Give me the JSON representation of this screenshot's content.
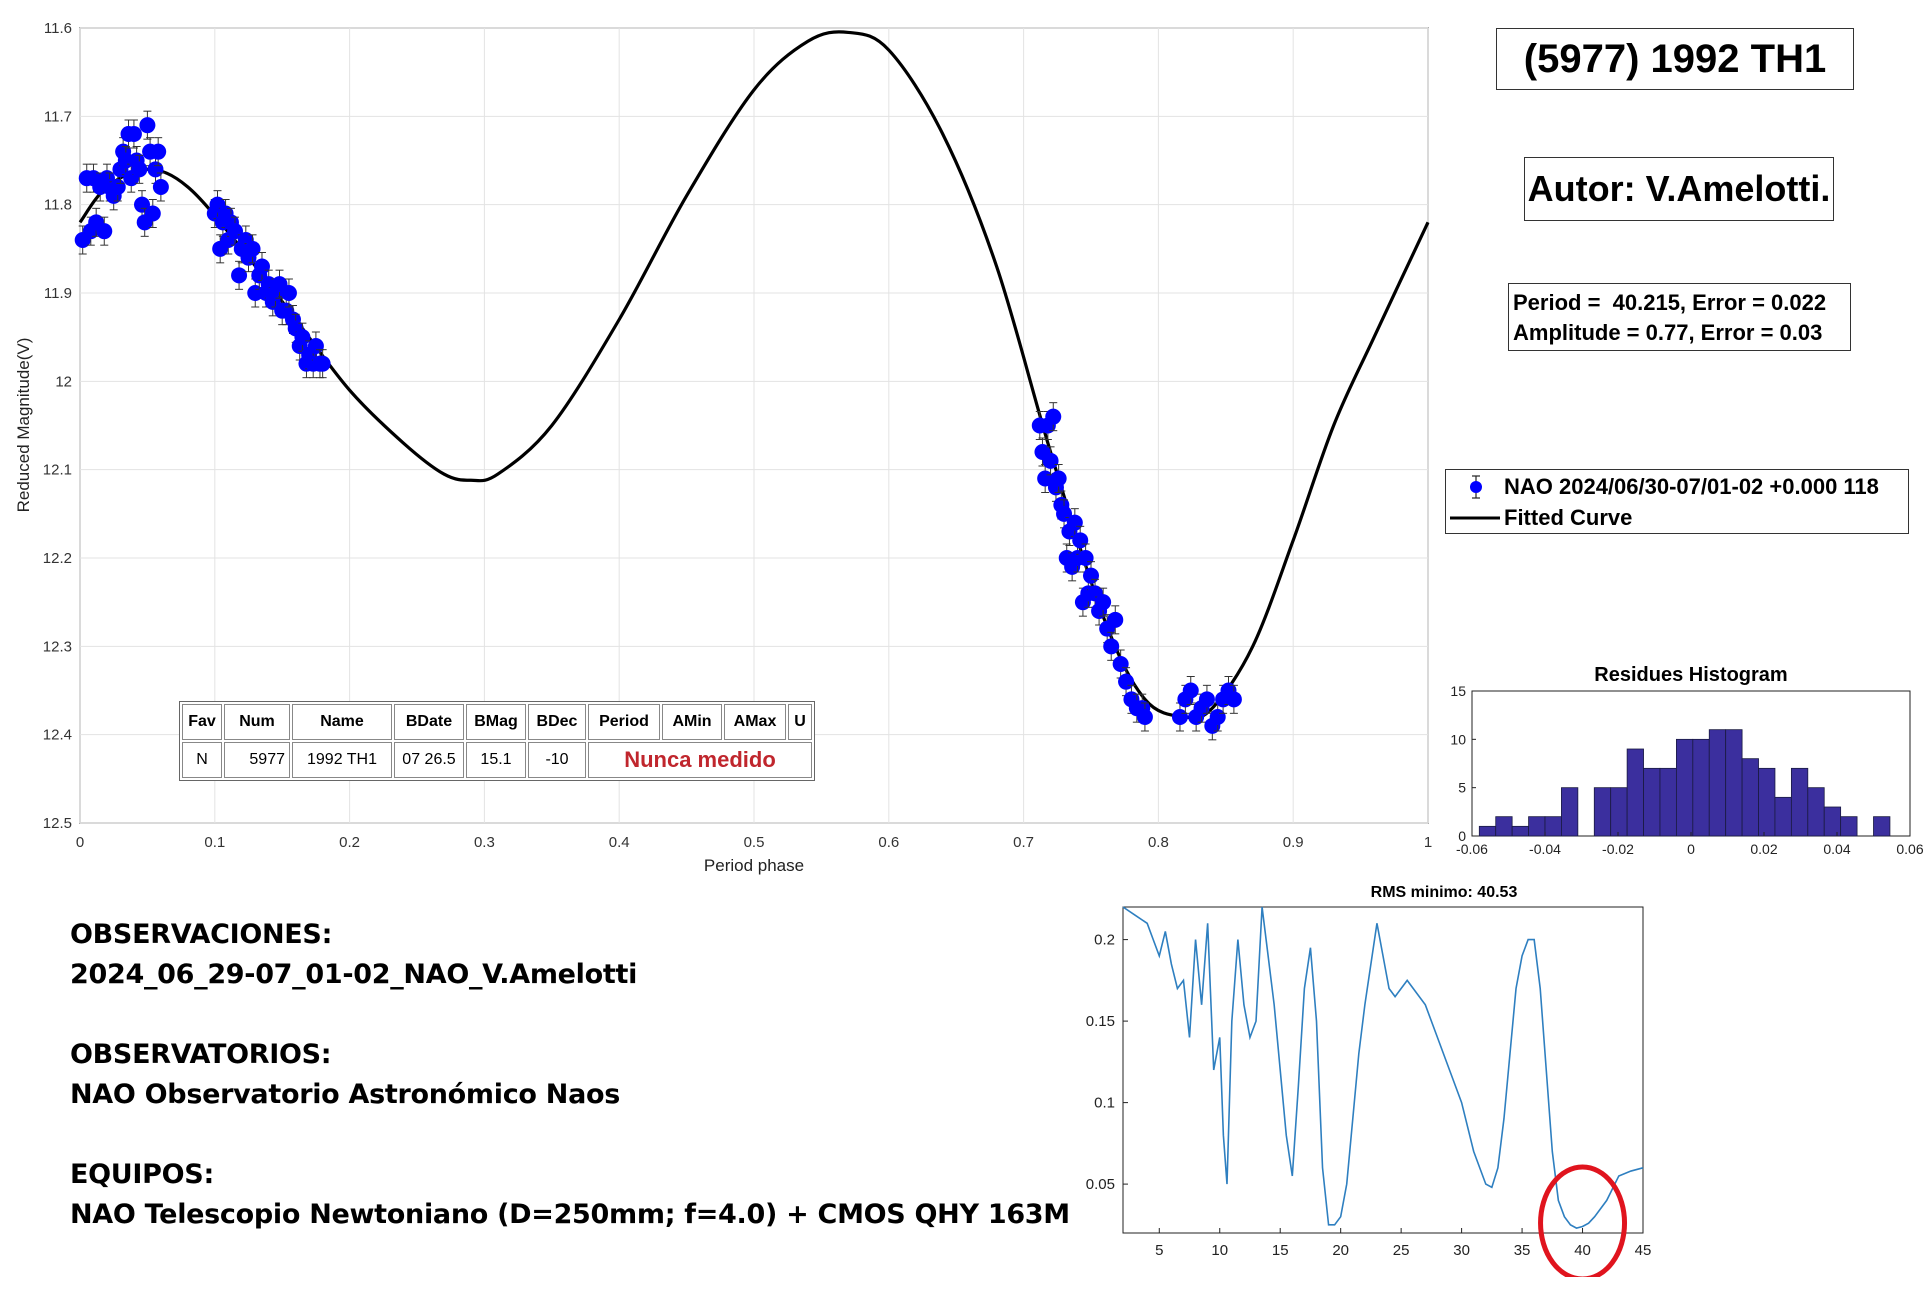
{
  "title": "(5977) 1992 TH1",
  "author": "Autor: V.Amelotti.",
  "params": {
    "period_line": "Period =  40.215, Error = 0.022",
    "amplitude_line": "Amplitude = 0.77, Error = 0.03"
  },
  "legend": {
    "series_label": "NAO 2024/06/30-07/01-02 +0.000 118",
    "fit_label": "Fitted Curve"
  },
  "observations": {
    "obs_header": "OBSERVACIONES:",
    "obs_value": "2024_06_29-07_01-02_NAO_V.Amelotti",
    "obsv_header": "OBSERVATORIOS:",
    "obsv_value": "NAO Observatorio Astronómico Naos",
    "equip_header": "EQUIPOS:",
    "equip_value": "NAO Telescopio Newtoniano (D=250mm; f=4.0) + CMOS QHY 163M"
  },
  "info_table": {
    "headers": [
      "Fav",
      "Num",
      "Name",
      "BDate",
      "BMag",
      "BDec",
      "Period",
      "AMin",
      "AMax",
      "U"
    ],
    "row": [
      "N",
      "5977",
      "1992 TH1",
      "07 26.5",
      "15.1",
      "-10"
    ],
    "note": "Nunca medido"
  },
  "colors": {
    "points": "#0000ff",
    "fit": "#000000",
    "histogram": "#3b2f9e",
    "rms": "#2e7fc0",
    "circle": "#e0141e"
  },
  "chart_data": [
    {
      "type": "scatter",
      "xlabel": "Period phase",
      "ylabel": "Reduced Magnitude(V)",
      "xlim": [
        0,
        1
      ],
      "ylim": [
        12.5,
        11.6
      ],
      "y_reversed": true,
      "grid": true,
      "xticks": [
        "0",
        "0.1",
        "0.2",
        "0.3",
        "0.4",
        "0.5",
        "0.6",
        "0.7",
        "0.8",
        "0.9",
        "1"
      ],
      "yticks": [
        "11.6",
        "11.7",
        "11.8",
        "11.9",
        "12",
        "12.1",
        "12.2",
        "12.3",
        "12.4",
        "12.5"
      ],
      "fit": {
        "type": "line",
        "name": "Fitted Curve",
        "x": [
          0,
          0.02,
          0.05,
          0.08,
          0.12,
          0.16,
          0.2,
          0.24,
          0.27,
          0.29,
          0.31,
          0.35,
          0.4,
          0.45,
          0.5,
          0.54,
          0.57,
          0.6,
          0.64,
          0.68,
          0.72,
          0.76,
          0.79,
          0.82,
          0.84,
          0.87,
          0.9,
          0.93,
          0.96,
          1.0
        ],
        "y": [
          11.82,
          11.78,
          11.76,
          11.78,
          11.85,
          11.93,
          12.01,
          12.07,
          12.105,
          12.112,
          12.105,
          12.05,
          11.93,
          11.79,
          11.67,
          11.615,
          11.605,
          11.625,
          11.72,
          11.87,
          12.08,
          12.27,
          12.36,
          12.38,
          12.37,
          12.3,
          12.18,
          12.05,
          11.95,
          11.82
        ]
      },
      "series": [
        {
          "name": "NAO 2024/06/30-07/01-02 +0.000 118",
          "x": [
            0.002,
            0.005,
            0.008,
            0.01,
            0.012,
            0.015,
            0.018,
            0.02,
            0.022,
            0.025,
            0.028,
            0.03,
            0.032,
            0.034,
            0.036,
            0.038,
            0.04,
            0.042,
            0.044,
            0.046,
            0.048,
            0.05,
            0.052,
            0.054,
            0.056,
            0.058,
            0.06,
            0.1,
            0.102,
            0.104,
            0.106,
            0.108,
            0.11,
            0.112,
            0.115,
            0.118,
            0.12,
            0.123,
            0.125,
            0.128,
            0.13,
            0.133,
            0.135,
            0.138,
            0.14,
            0.143,
            0.145,
            0.148,
            0.15,
            0.153,
            0.155,
            0.158,
            0.16,
            0.163,
            0.165,
            0.168,
            0.17,
            0.173,
            0.175,
            0.178,
            0.18,
            0.712,
            0.714,
            0.716,
            0.718,
            0.72,
            0.722,
            0.724,
            0.726,
            0.728,
            0.73,
            0.732,
            0.734,
            0.736,
            0.738,
            0.74,
            0.742,
            0.744,
            0.746,
            0.748,
            0.75,
            0.753,
            0.756,
            0.759,
            0.762,
            0.765,
            0.768,
            0.772,
            0.776,
            0.78,
            0.784,
            0.788,
            0.79,
            0.816,
            0.82,
            0.824,
            0.828,
            0.832,
            0.836,
            0.84,
            0.844,
            0.848,
            0.852,
            0.856
          ],
          "y": [
            11.84,
            11.77,
            11.83,
            11.77,
            11.82,
            11.78,
            11.83,
            11.77,
            11.78,
            11.79,
            11.78,
            11.76,
            11.74,
            11.75,
            11.72,
            11.77,
            11.72,
            11.75,
            11.76,
            11.8,
            11.82,
            11.71,
            11.74,
            11.81,
            11.76,
            11.74,
            11.78,
            11.81,
            11.8,
            11.85,
            11.82,
            11.81,
            11.84,
            11.82,
            11.83,
            11.88,
            11.85,
            11.84,
            11.86,
            11.85,
            11.9,
            11.88,
            11.87,
            11.9,
            11.89,
            11.91,
            11.9,
            11.89,
            11.92,
            11.92,
            11.9,
            11.93,
            11.94,
            11.96,
            11.95,
            11.98,
            11.97,
            11.98,
            11.96,
            11.98,
            11.98,
            12.05,
            12.08,
            12.11,
            12.05,
            12.09,
            12.04,
            12.12,
            12.11,
            12.14,
            12.15,
            12.2,
            12.17,
            12.21,
            12.16,
            12.2,
            12.18,
            12.25,
            12.2,
            12.24,
            12.22,
            12.24,
            12.26,
            12.25,
            12.28,
            12.3,
            12.27,
            12.32,
            12.34,
            12.36,
            12.37,
            12.37,
            12.38,
            12.38,
            12.36,
            12.35,
            12.38,
            12.37,
            12.36,
            12.39,
            12.38,
            12.36,
            12.35,
            12.36
          ]
        }
      ]
    },
    {
      "type": "bar",
      "title": "Residues Histogram",
      "xlim": [
        -0.06,
        0.06
      ],
      "ylim": [
        0,
        15
      ],
      "xticks": [
        "-0.06",
        "-0.04",
        "-0.02",
        "0",
        "0.02",
        "0.04",
        "0.06"
      ],
      "yticks": [
        "0",
        "5",
        "10",
        "15"
      ],
      "bin_width": 0.0045,
      "bin_left_edges": [
        -0.058,
        -0.0535,
        -0.049,
        -0.0445,
        -0.04,
        -0.0355,
        -0.031,
        -0.0265,
        -0.022,
        -0.0175,
        -0.013,
        -0.0085,
        -0.004,
        0.0005,
        0.005,
        0.0095,
        0.014,
        0.0185,
        0.023,
        0.0275,
        0.032,
        0.0365,
        0.041,
        0.0455,
        0.05
      ],
      "values": [
        1,
        2,
        1,
        2,
        2,
        5,
        0,
        5,
        5,
        9,
        7,
        7,
        10,
        10,
        11,
        11,
        8,
        7,
        4,
        7,
        5,
        3,
        2,
        0,
        2
      ]
    },
    {
      "type": "line",
      "title": "RMS minimo: 40.53",
      "xlim": [
        2,
        45
      ],
      "ylim": [
        0.02,
        0.22
      ],
      "xticks": [
        "5",
        "10",
        "15",
        "20",
        "25",
        "30",
        "35",
        "40",
        "45"
      ],
      "yticks": [
        "0.05",
        "0.1",
        "0.15",
        "0.2"
      ],
      "x": [
        2,
        3,
        4,
        4.5,
        5,
        5.5,
        6,
        6.5,
        7,
        7.5,
        8,
        8.5,
        9,
        9.5,
        10,
        10.3,
        10.6,
        11,
        11.5,
        12,
        12.5,
        13,
        13.5,
        14,
        14.5,
        15,
        15.5,
        16,
        16.5,
        17,
        17.5,
        18,
        18.5,
        19,
        19.5,
        20,
        20.5,
        21,
        21.5,
        22,
        22.5,
        23,
        23.5,
        24,
        24.5,
        25,
        25.5,
        26,
        27,
        28,
        29,
        30,
        31,
        32,
        32.5,
        33,
        33.5,
        34,
        34.5,
        35,
        35.5,
        36,
        36.5,
        37,
        37.5,
        38,
        38.5,
        39,
        39.5,
        40,
        40.5,
        41,
        42,
        43,
        44,
        45
      ],
      "y": [
        0.22,
        0.215,
        0.21,
        0.2,
        0.19,
        0.205,
        0.185,
        0.17,
        0.175,
        0.14,
        0.2,
        0.16,
        0.21,
        0.12,
        0.14,
        0.08,
        0.05,
        0.15,
        0.2,
        0.16,
        0.14,
        0.15,
        0.22,
        0.19,
        0.16,
        0.12,
        0.08,
        0.055,
        0.11,
        0.17,
        0.195,
        0.15,
        0.06,
        0.025,
        0.025,
        0.03,
        0.05,
        0.09,
        0.13,
        0.16,
        0.185,
        0.21,
        0.19,
        0.17,
        0.165,
        0.17,
        0.175,
        0.17,
        0.16,
        0.14,
        0.12,
        0.1,
        0.07,
        0.05,
        0.048,
        0.06,
        0.09,
        0.13,
        0.17,
        0.19,
        0.2,
        0.2,
        0.17,
        0.12,
        0.07,
        0.04,
        0.03,
        0.025,
        0.023,
        0.024,
        0.026,
        0.03,
        0.04,
        0.055,
        0.058,
        0.06
      ],
      "highlight_min_x": 40
    }
  ]
}
